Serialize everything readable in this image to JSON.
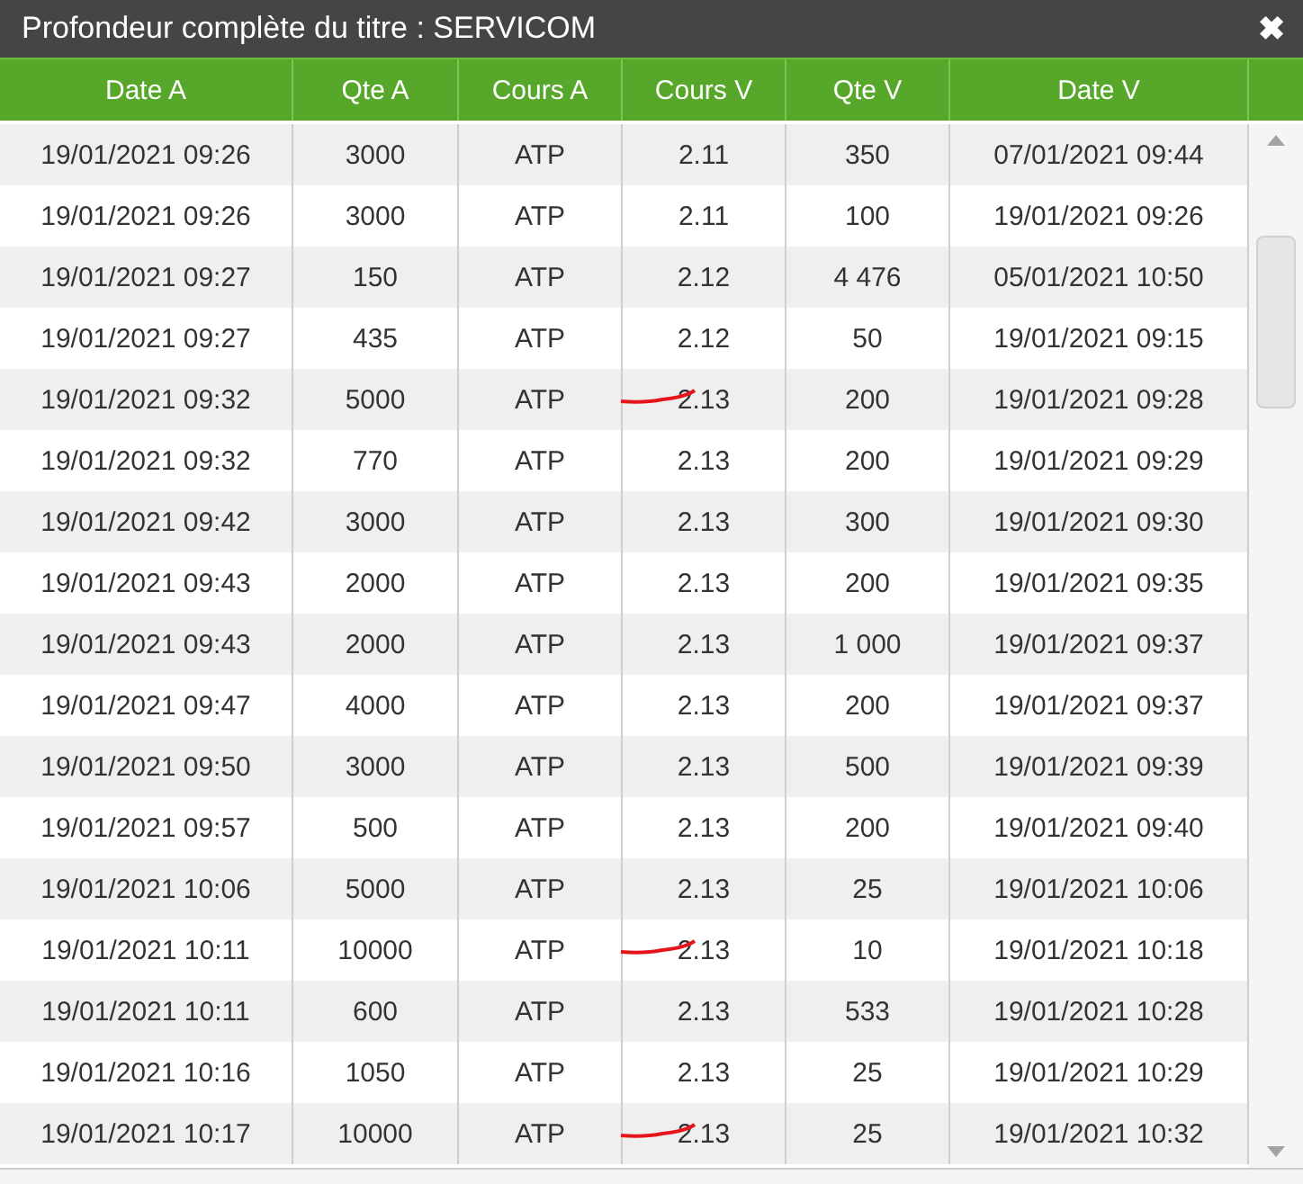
{
  "window": {
    "title": "Profondeur complète du titre : SERVICOM",
    "close": "✖"
  },
  "table": {
    "columns": [
      "Date A",
      "Qte A",
      "Cours A",
      "Cours V",
      "Qte V",
      "Date V"
    ],
    "rows": [
      {
        "cells": [
          "19/01/2021 09:26",
          "3000",
          "ATP",
          "2.11",
          "350",
          "07/01/2021 09:44"
        ],
        "marked": false
      },
      {
        "cells": [
          "19/01/2021 09:26",
          "3000",
          "ATP",
          "2.11",
          "100",
          "19/01/2021 09:26"
        ],
        "marked": false
      },
      {
        "cells": [
          "19/01/2021 09:27",
          "150",
          "ATP",
          "2.12",
          "4 476",
          "05/01/2021 10:50"
        ],
        "marked": false
      },
      {
        "cells": [
          "19/01/2021 09:27",
          "435",
          "ATP",
          "2.12",
          "50",
          "19/01/2021 09:15"
        ],
        "marked": false
      },
      {
        "cells": [
          "19/01/2021 09:32",
          "5000",
          "ATP",
          "2.13",
          "200",
          "19/01/2021 09:28"
        ],
        "marked": true
      },
      {
        "cells": [
          "19/01/2021 09:32",
          "770",
          "ATP",
          "2.13",
          "200",
          "19/01/2021 09:29"
        ],
        "marked": false
      },
      {
        "cells": [
          "19/01/2021 09:42",
          "3000",
          "ATP",
          "2.13",
          "300",
          "19/01/2021 09:30"
        ],
        "marked": false
      },
      {
        "cells": [
          "19/01/2021 09:43",
          "2000",
          "ATP",
          "2.13",
          "200",
          "19/01/2021 09:35"
        ],
        "marked": false
      },
      {
        "cells": [
          "19/01/2021 09:43",
          "2000",
          "ATP",
          "2.13",
          "1 000",
          "19/01/2021 09:37"
        ],
        "marked": false
      },
      {
        "cells": [
          "19/01/2021 09:47",
          "4000",
          "ATP",
          "2.13",
          "200",
          "19/01/2021 09:37"
        ],
        "marked": false
      },
      {
        "cells": [
          "19/01/2021 09:50",
          "3000",
          "ATP",
          "2.13",
          "500",
          "19/01/2021 09:39"
        ],
        "marked": false
      },
      {
        "cells": [
          "19/01/2021 09:57",
          "500",
          "ATP",
          "2.13",
          "200",
          "19/01/2021 09:40"
        ],
        "marked": false
      },
      {
        "cells": [
          "19/01/2021 10:06",
          "5000",
          "ATP",
          "2.13",
          "25",
          "19/01/2021 10:06"
        ],
        "marked": false
      },
      {
        "cells": [
          "19/01/2021 10:11",
          "10000",
          "ATP",
          "2.13",
          "10",
          "19/01/2021 10:18"
        ],
        "marked": true
      },
      {
        "cells": [
          "19/01/2021 10:11",
          "600",
          "ATP",
          "2.13",
          "533",
          "19/01/2021 10:28"
        ],
        "marked": false
      },
      {
        "cells": [
          "19/01/2021 10:16",
          "1050",
          "ATP",
          "2.13",
          "25",
          "19/01/2021 10:29"
        ],
        "marked": false
      },
      {
        "cells": [
          "19/01/2021 10:17",
          "10000",
          "ATP",
          "2.13",
          "25",
          "19/01/2021 10:32"
        ],
        "marked": true
      }
    ]
  }
}
